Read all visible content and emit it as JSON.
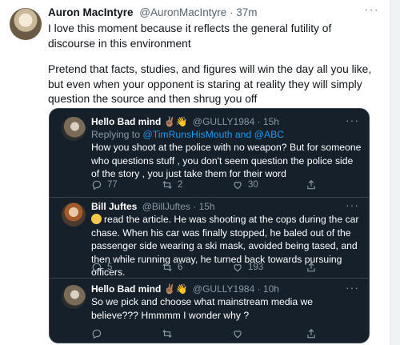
{
  "main_tweet": {
    "author_name": "Auron MacIntyre",
    "handle_time": "@AuronMacIntyre · 37m",
    "paragraph1": "I love this moment because it reflects the general futility of discourse in this environment",
    "paragraph2": "Pretend that facts, studies, and figures will win the day all you like, but even when your opponent is staring at reality they will simply question the source and then shrug you off"
  },
  "quoted_thread": {
    "tweets": [
      {
        "name": "Hello Bad mind ✌🏽👋",
        "meta": "@GULLY1984 · 15h",
        "replying_prefix": "Replying to ",
        "replying_mentions": "@TimRunsHisMouth and @ABC",
        "text": "How you shoot at the police with no weapon? But for someone who questions stuff , you don't seem question the police side of the story , you just take them for their word",
        "replies": "77",
        "retweets": "2",
        "likes": "30"
      },
      {
        "name": "Bill Juftes",
        "meta": "@BillJuftes · 15h",
        "text": "read the article. He was shooting at the cops during the car chase. When his car was finally stopped, he baled out of the passenger side wearing a ski mask, avoided being tased, and then while running away, he turned back towards pursuing officers.",
        "replies": "5",
        "retweets": "6",
        "likes": "193"
      },
      {
        "name": "Hello Bad mind ✌🏽👋",
        "meta": "@GULLY1984 · 10h",
        "text": "So we pick and choose what mainstream media we believe??? Hmmmm I wonder why ?"
      }
    ],
    "more_icon": "···"
  },
  "icons": [
    "more-icon",
    "reply-icon",
    "retweet-icon",
    "like-icon",
    "share-icon"
  ],
  "colors": {
    "dark_bg": "#15202b",
    "link": "#1d9bf0",
    "muted": "#8899a6"
  }
}
